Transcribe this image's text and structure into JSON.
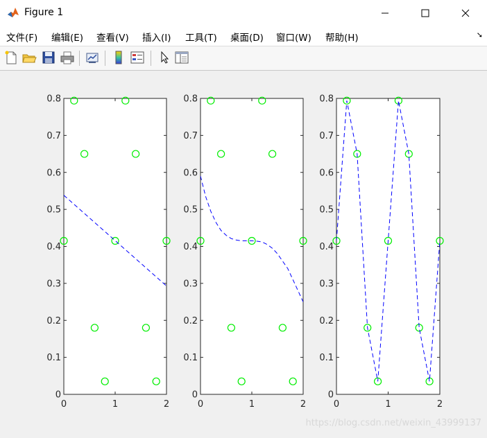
{
  "window": {
    "title": "Figure 1"
  },
  "menu": {
    "items": [
      "文件(F)",
      "编辑(E)",
      "查看(V)",
      "插入(I)",
      "工具(T)",
      "桌面(D)",
      "窗口(W)",
      "帮助(H)"
    ]
  },
  "toolbar": {
    "icons": [
      "new-figure-icon",
      "open-file-icon",
      "save-icon",
      "print-icon",
      "link-plot-icon",
      "insert-colorbar-icon",
      "insert-legend-icon",
      "select-arrow-icon",
      "property-inspector-icon"
    ]
  },
  "watermark": "https://blog.csdn.net/weixin_43999137",
  "colors": {
    "markers": "#00ee00",
    "fit_line": "#0000ff",
    "axes": "#262626"
  },
  "chart_data": [
    {
      "type": "line",
      "xlim": [
        0,
        2
      ],
      "ylim": [
        0,
        0.8
      ],
      "xticks": [
        0,
        1,
        2
      ],
      "yticks": [
        0,
        0.1,
        0.2,
        0.3,
        0.4,
        0.5,
        0.6,
        0.7,
        0.8
      ],
      "grid": false,
      "series": [
        {
          "style": "markers-circle",
          "x": [
            0,
            0.2,
            0.4,
            0.6,
            0.8,
            1.0,
            1.2,
            1.4,
            1.6,
            1.8,
            2.0
          ],
          "y": [
            0.415,
            0.794,
            0.65,
            0.18,
            0.035,
            0.415,
            0.794,
            0.65,
            0.18,
            0.035,
            0.415
          ]
        },
        {
          "style": "dashed",
          "x": [
            0,
            2
          ],
          "y": [
            0.538,
            0.293
          ]
        }
      ]
    },
    {
      "type": "line",
      "xlim": [
        0,
        2
      ],
      "ylim": [
        0,
        0.8
      ],
      "xticks": [
        0,
        1,
        2
      ],
      "yticks": [
        0,
        0.1,
        0.2,
        0.3,
        0.4,
        0.5,
        0.6,
        0.7,
        0.8
      ],
      "grid": false,
      "series": [
        {
          "style": "markers-circle",
          "x": [
            0,
            0.2,
            0.4,
            0.6,
            0.8,
            1.0,
            1.2,
            1.4,
            1.6,
            1.8,
            2.0
          ],
          "y": [
            0.415,
            0.794,
            0.65,
            0.18,
            0.035,
            0.415,
            0.794,
            0.65,
            0.18,
            0.035,
            0.415
          ]
        },
        {
          "style": "dashed",
          "x": [
            0,
            0.1,
            0.2,
            0.3,
            0.4,
            0.5,
            0.6,
            0.7,
            0.8,
            0.9,
            1.0,
            1.1,
            1.2,
            1.3,
            1.4,
            1.5,
            1.6,
            1.7,
            1.8,
            1.9,
            2.0
          ],
          "y": [
            0.59,
            0.535,
            0.495,
            0.465,
            0.443,
            0.43,
            0.421,
            0.417,
            0.415,
            0.415,
            0.415,
            0.414,
            0.412,
            0.405,
            0.395,
            0.38,
            0.36,
            0.34,
            0.31,
            0.28,
            0.25
          ]
        }
      ]
    },
    {
      "type": "line",
      "xlim": [
        0,
        2
      ],
      "ylim": [
        0,
        0.8
      ],
      "xticks": [
        0,
        1,
        2
      ],
      "yticks": [
        0,
        0.1,
        0.2,
        0.3,
        0.4,
        0.5,
        0.6,
        0.7,
        0.8
      ],
      "grid": false,
      "series": [
        {
          "style": "markers-circle",
          "x": [
            0,
            0.2,
            0.4,
            0.6,
            0.8,
            1.0,
            1.2,
            1.4,
            1.6,
            1.8,
            2.0
          ],
          "y": [
            0.415,
            0.794,
            0.65,
            0.18,
            0.035,
            0.415,
            0.794,
            0.65,
            0.18,
            0.035,
            0.415
          ]
        },
        {
          "style": "dashed",
          "x": [
            0,
            0.2,
            0.4,
            0.6,
            0.8,
            1.0,
            1.2,
            1.4,
            1.6,
            1.8,
            2.0
          ],
          "y": [
            0.415,
            0.794,
            0.65,
            0.18,
            0.035,
            0.415,
            0.794,
            0.65,
            0.18,
            0.035,
            0.415
          ]
        }
      ]
    }
  ]
}
